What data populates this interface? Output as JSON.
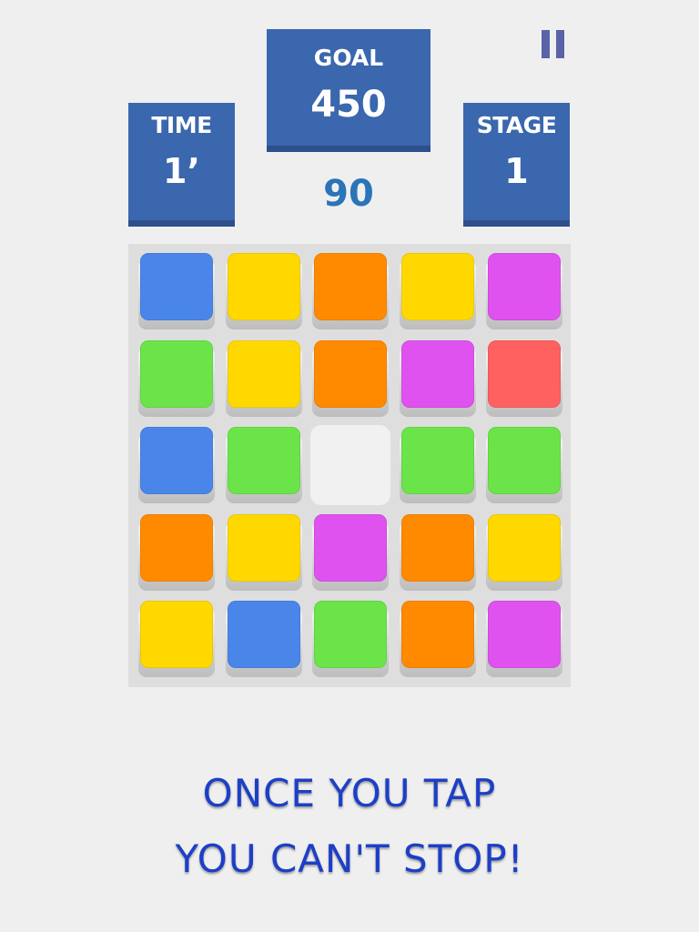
{
  "hud": {
    "time": {
      "label": "TIME",
      "value": "1’"
    },
    "goal": {
      "label": "GOAL",
      "value": "450"
    },
    "stage": {
      "label": "STAGE",
      "value": "1"
    },
    "moves": "90",
    "pause_icon": "pause-icon"
  },
  "colors": {
    "blue": "#4a86ea",
    "yellow": "#ffd800",
    "orange": "#ff8a00",
    "magenta": "#e052f0",
    "green": "#6be44a",
    "red": "#ff6060",
    "empty": "#f1f1f1"
  },
  "grid": [
    [
      "blue",
      "yellow",
      "orange",
      "yellow",
      "magenta"
    ],
    [
      "green",
      "yellow",
      "orange",
      "magenta",
      "red"
    ],
    [
      "blue",
      "green",
      "empty",
      "green",
      "green"
    ],
    [
      "orange",
      "yellow",
      "magenta",
      "orange",
      "yellow"
    ],
    [
      "yellow",
      "blue",
      "green",
      "orange",
      "magenta"
    ]
  ],
  "tagline": {
    "line1": "ONCE YOU TAP",
    "line2": "YOU CAN'T STOP!"
  }
}
